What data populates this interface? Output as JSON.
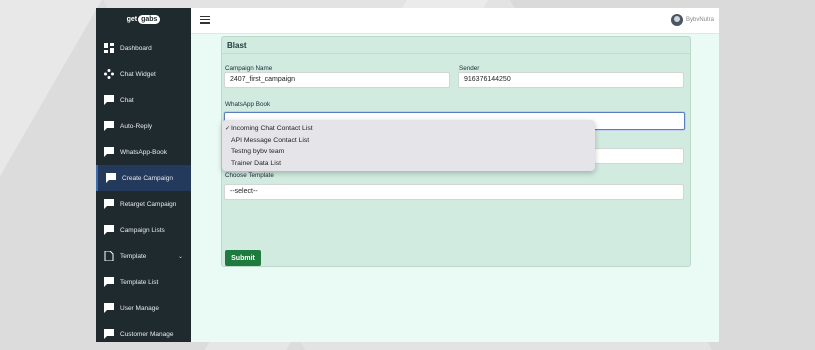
{
  "brand": {
    "prefix": "get",
    "name": "gabs"
  },
  "sidebar": {
    "items": [
      {
        "label": "Dashboard",
        "icon": "dashboard-icon"
      },
      {
        "label": "Chat Widget",
        "icon": "widget-icon"
      },
      {
        "label": "Chat",
        "icon": "chat-icon"
      },
      {
        "label": "Auto-Reply",
        "icon": "chat-icon"
      },
      {
        "label": "WhatsApp-Book",
        "icon": "chat-icon"
      },
      {
        "label": "Create Campaign",
        "icon": "chat-icon",
        "active": true
      },
      {
        "label": "Retarget Campaign",
        "icon": "chat-icon"
      },
      {
        "label": "Campaign Lists",
        "icon": "chat-icon"
      },
      {
        "label": "Template",
        "icon": "file-icon"
      },
      {
        "label": "Template List",
        "icon": "chat-icon"
      },
      {
        "label": "User Manage",
        "icon": "chat-icon"
      },
      {
        "label": "Customer Manage",
        "icon": "chat-icon"
      }
    ]
  },
  "header": {
    "user_name": "BybvNutra"
  },
  "form": {
    "title": "Blast",
    "campaign_name_label": "Campaign Name",
    "campaign_name_value": "2407_first_campaign",
    "sender_label": "Sender",
    "sender_value": "916376144250",
    "book_label": "WhatsApp Book",
    "book_options": [
      {
        "label": "Incoming Chat Contact List",
        "selected": true
      },
      {
        "label": "API Message Contact List",
        "selected": false
      },
      {
        "label": "Testng bybv team",
        "selected": false
      },
      {
        "label": "Trainer Data List",
        "selected": false
      }
    ],
    "check_mark": "✓",
    "template_label": "Choose Template",
    "template_value": "--select--",
    "submit_label": "Submit"
  },
  "colors": {
    "sidebar": "#1f2a2e",
    "content_bg": "#e9fbf4",
    "card": "#d1ebe0",
    "submit": "#1f7a3f",
    "active_item": "#243a5c"
  }
}
